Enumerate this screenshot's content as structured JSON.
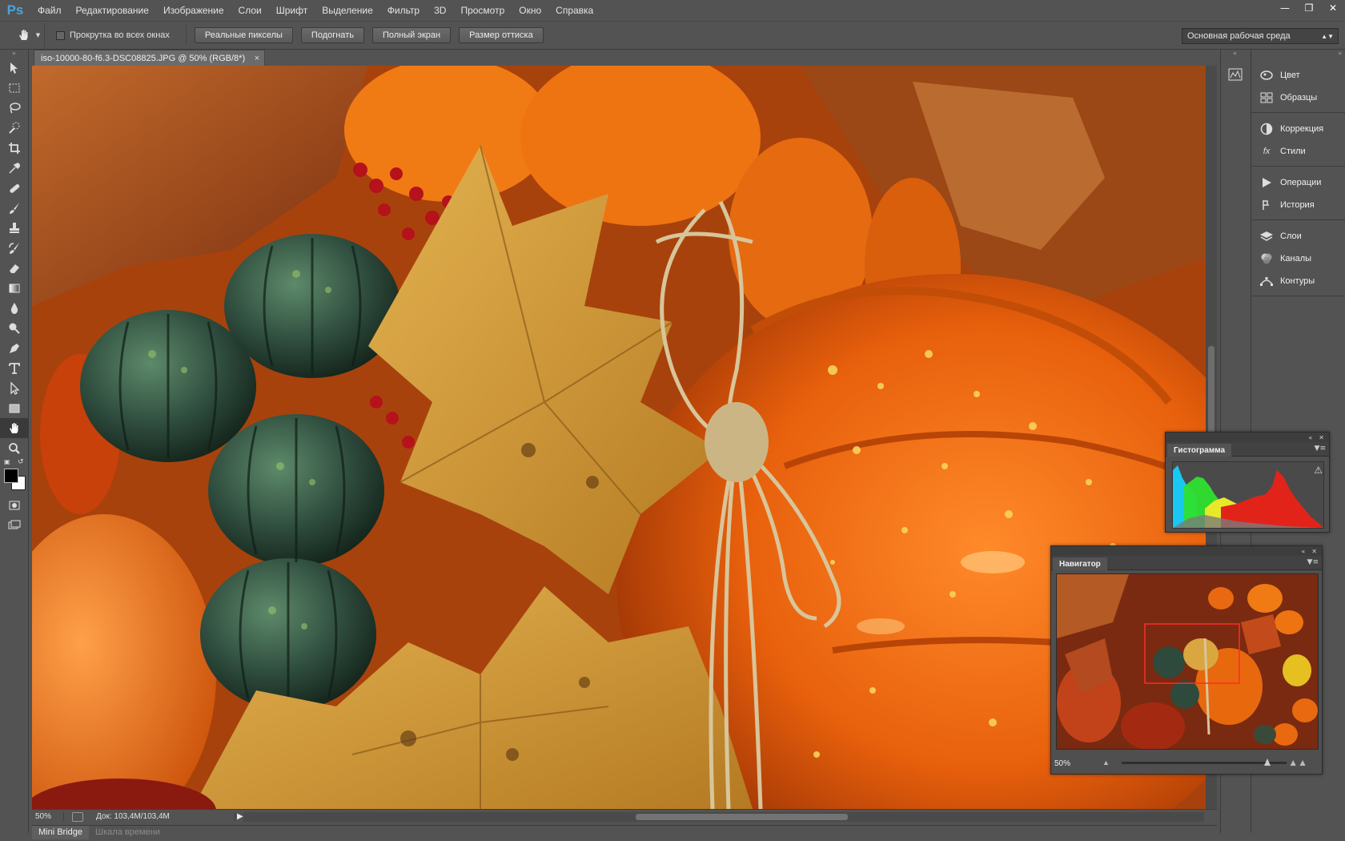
{
  "app": {
    "logo": "Ps",
    "menu": [
      "Файл",
      "Редактирование",
      "Изображение",
      "Слои",
      "Шрифт",
      "Выделение",
      "Фильтр",
      "3D",
      "Просмотр",
      "Окно",
      "Справка"
    ]
  },
  "options": {
    "scroll_all_label": "Прокрутка во всех окнах",
    "buttons": [
      "Реальные пикселы",
      "Подогнать",
      "Полный экран",
      "Размер оттиска"
    ],
    "workspace": "Основная рабочая среда"
  },
  "document": {
    "tab_title": "iso-10000-80-f6.3-DSC08825.JPG @ 50% (RGB/8*)",
    "close": "×"
  },
  "status": {
    "zoom": "50%",
    "doc_size": "Док: 103,4M/103,4M"
  },
  "bottom_tabs": [
    "Mini Bridge",
    "Шкала времени"
  ],
  "panels": {
    "groups": [
      [
        {
          "icon": "color-icon",
          "label": "Цвет"
        },
        {
          "icon": "swatches-icon",
          "label": "Образцы"
        }
      ],
      [
        {
          "icon": "adjustments-icon",
          "label": "Коррекция"
        },
        {
          "icon": "styles-icon",
          "label": "Стили"
        }
      ],
      [
        {
          "icon": "actions-icon",
          "label": "Операции"
        },
        {
          "icon": "history-icon",
          "label": "История"
        }
      ],
      [
        {
          "icon": "layers-icon",
          "label": "Слои"
        },
        {
          "icon": "channels-icon",
          "label": "Каналы"
        },
        {
          "icon": "paths-icon",
          "label": "Контуры"
        }
      ]
    ]
  },
  "histogram": {
    "title": "Гистограмма",
    "warning": "⚠"
  },
  "navigator": {
    "title": "Навигатор",
    "zoom": "50%"
  },
  "colors": {
    "accent": "#4aa3df",
    "panel_bg": "#535353",
    "canvas_orange": "#e8690f"
  }
}
